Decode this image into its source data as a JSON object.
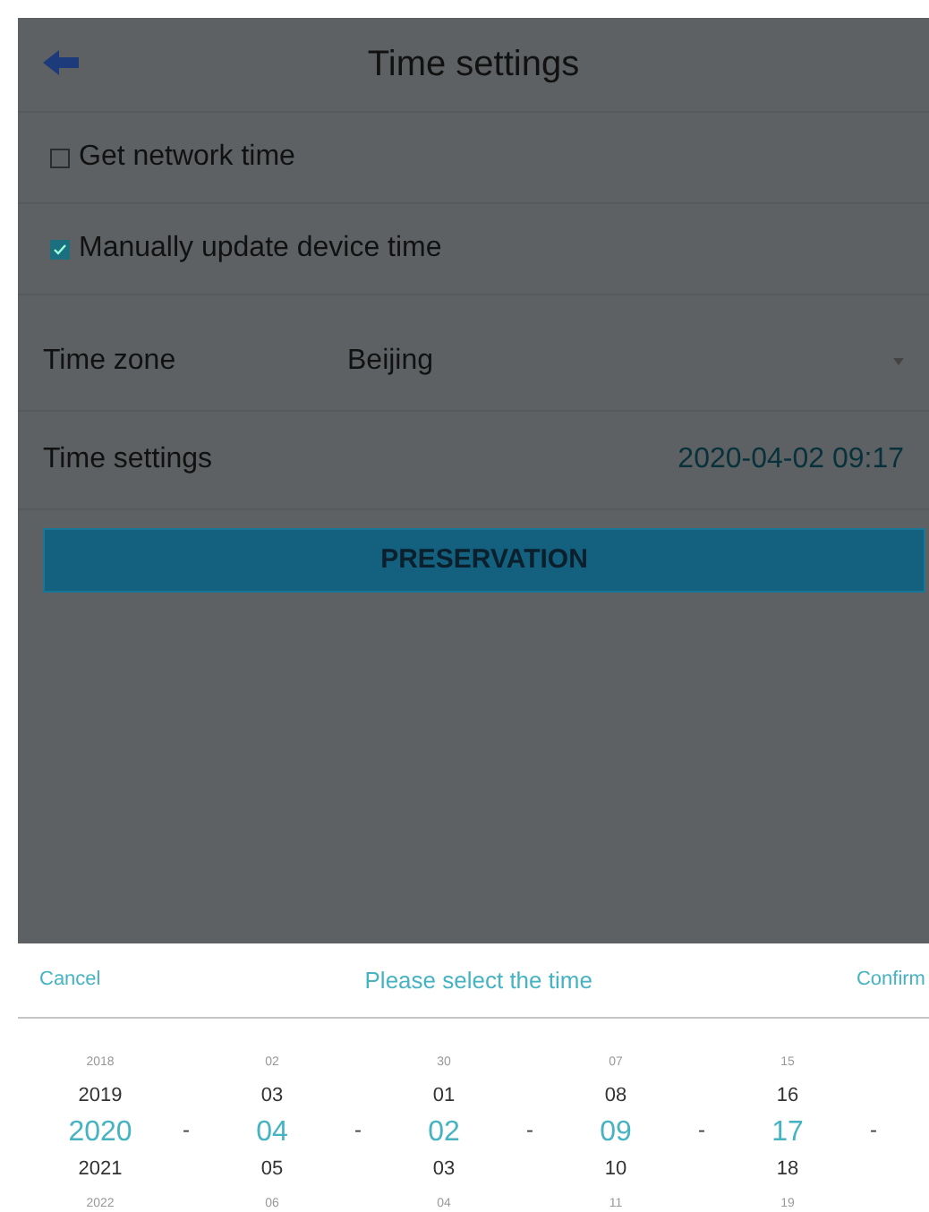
{
  "header": {
    "title": "Time settings"
  },
  "options": [
    {
      "label": "Get network time",
      "checked": false
    },
    {
      "label": "Manually update device time",
      "checked": true
    }
  ],
  "fields": [
    {
      "kind": "dropdown",
      "label": "Time zone",
      "value": "Beijing"
    },
    {
      "kind": "value",
      "label": "Time settings",
      "value": "2020-04-02 09:17"
    }
  ],
  "save_button": "PRESERVATION",
  "picker": {
    "cancel": "Cancel",
    "title": "Please select the time",
    "confirm": "Confirm",
    "columns": [
      {
        "separator": "-",
        "items": [
          {
            "text": "2018",
            "selected": false
          },
          {
            "text": "2019",
            "selected": false
          },
          {
            "text": "2020",
            "selected": true
          },
          {
            "text": "2021",
            "selected": false
          },
          {
            "text": "2022",
            "selected": false
          }
        ]
      },
      {
        "separator": "-",
        "items": [
          {
            "text": "02",
            "selected": false
          },
          {
            "text": "03",
            "selected": false
          },
          {
            "text": "04",
            "selected": true
          },
          {
            "text": "05",
            "selected": false
          },
          {
            "text": "06",
            "selected": false
          }
        ]
      },
      {
        "separator": "-",
        "items": [
          {
            "text": "30",
            "selected": false
          },
          {
            "text": "01",
            "selected": false
          },
          {
            "text": "02",
            "selected": true
          },
          {
            "text": "03",
            "selected": false
          },
          {
            "text": "04",
            "selected": false
          }
        ]
      },
      {
        "separator": "-",
        "items": [
          {
            "text": "07",
            "selected": false
          },
          {
            "text": "08",
            "selected": false
          },
          {
            "text": "09",
            "selected": true
          },
          {
            "text": "10",
            "selected": false
          },
          {
            "text": "11",
            "selected": false
          }
        ]
      },
      {
        "separator": "-",
        "items": [
          {
            "text": "15",
            "selected": false
          },
          {
            "text": "16",
            "selected": false
          },
          {
            "text": "17",
            "selected": true
          },
          {
            "text": "18",
            "selected": false
          },
          {
            "text": "19",
            "selected": false
          }
        ]
      }
    ]
  }
}
